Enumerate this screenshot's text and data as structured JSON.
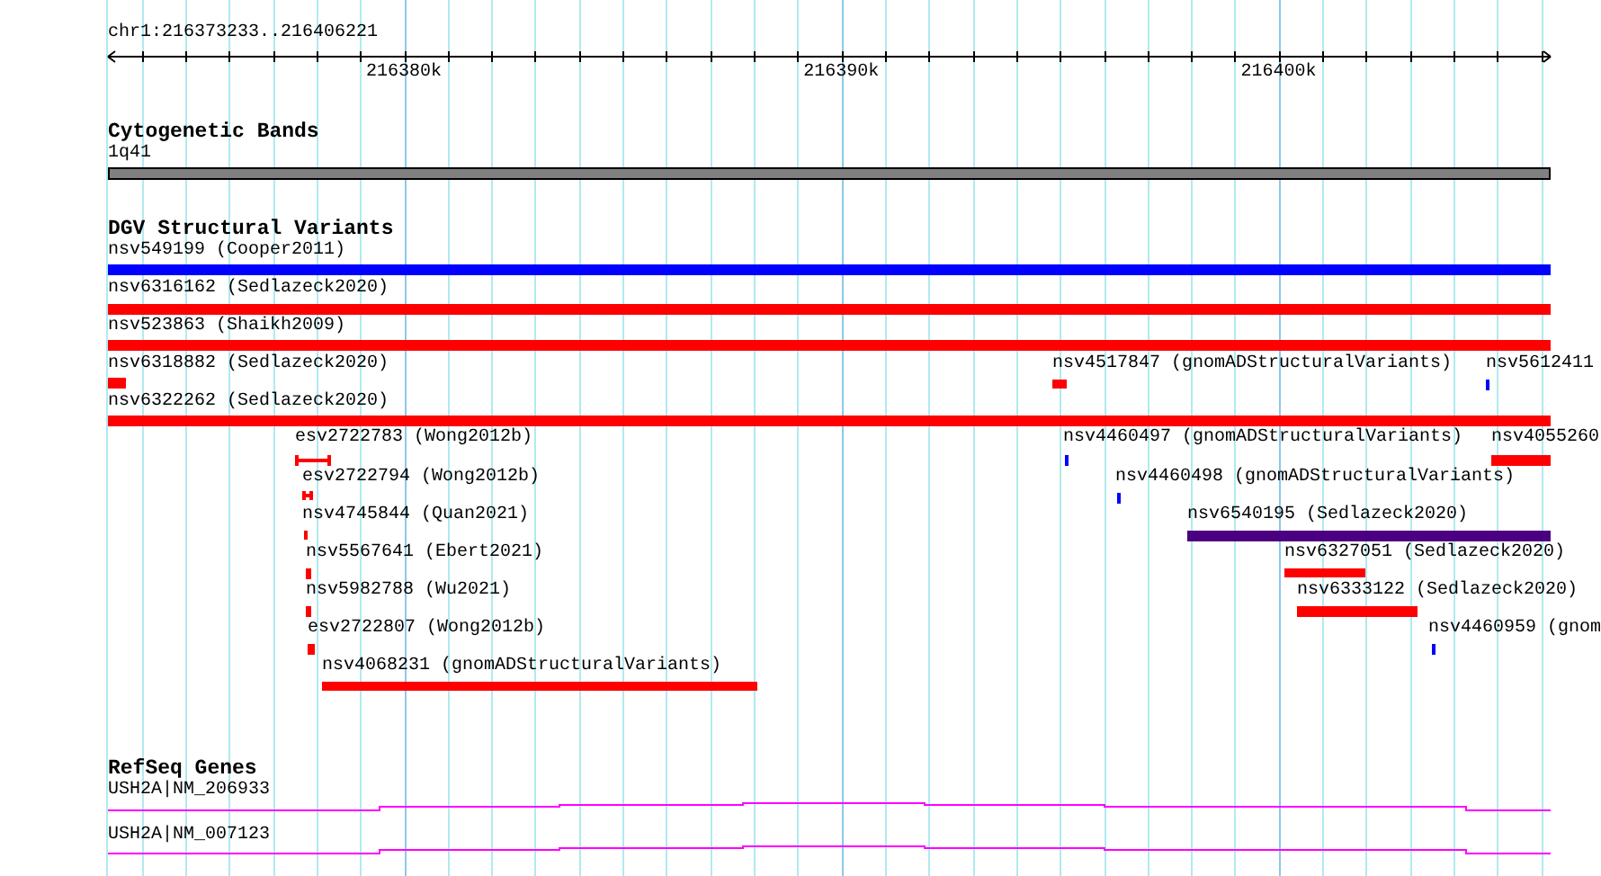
{
  "ruler": {
    "location": "chr1:216373233..216406221",
    "ticks": [
      "216380k",
      "216390k",
      "216400k"
    ]
  },
  "tracks": [
    {
      "kind": "cytoband",
      "title": "Cytogenetic Bands",
      "band": "1q41"
    },
    {
      "kind": "variants",
      "title": "DGV Structural Variants",
      "features": [
        {
          "label": "nsv549199 (Cooper2011)",
          "color": "#0000ff",
          "kind": "bar"
        },
        {
          "label": "nsv6316162 (Sedlazeck2020)",
          "color": "#ff0000",
          "kind": "bar"
        },
        {
          "label": "nsv523863 (Shaikh2009)",
          "color": "#ff0000",
          "kind": "bar"
        },
        {
          "label": "nsv6318882 (Sedlazeck2020)",
          "color": "#ff0000",
          "kind": "bar"
        },
        {
          "label": "nsv4517847 (gnomADStructuralVariants)",
          "color": "#ff0000",
          "kind": "bar"
        },
        {
          "label": "nsv5612411",
          "color": "#0000ff",
          "kind": "bar"
        },
        {
          "label": "nsv6322262 (Sedlazeck2020)",
          "color": "#ff0000",
          "kind": "bar"
        },
        {
          "label": "esv2722783 (Wong2012b)",
          "color": "#ff0000",
          "kind": "interval"
        },
        {
          "label": "nsv4460497 (gnomADStructuralVariants)",
          "color": "#0000ff",
          "kind": "bar"
        },
        {
          "label": "nsv4055260",
          "color": "#ff0000",
          "kind": "bar"
        },
        {
          "label": "esv2722794 (Wong2012b)",
          "color": "#ff0000",
          "kind": "interval"
        },
        {
          "label": "nsv4460498 (gnomADStructuralVariants)",
          "color": "#0000ff",
          "kind": "bar"
        },
        {
          "label": "nsv4745844 (Quan2021)",
          "color": "#ff0000",
          "kind": "bar"
        },
        {
          "label": "nsv6540195 (Sedlazeck2020)",
          "color": "#4b0082",
          "kind": "bar"
        },
        {
          "label": "nsv5567641 (Ebert2021)",
          "color": "#ff0000",
          "kind": "bar"
        },
        {
          "label": "nsv6327051 (Sedlazeck2020)",
          "color": "#ff0000",
          "kind": "bar"
        },
        {
          "label": "nsv5982788 (Wu2021)",
          "color": "#ff0000",
          "kind": "bar"
        },
        {
          "label": "nsv6333122 (Sedlazeck2020)",
          "color": "#ff0000",
          "kind": "bar"
        },
        {
          "label": "esv2722807 (Wong2012b)",
          "color": "#ff0000",
          "kind": "bar"
        },
        {
          "label": "nsv4460959 (gnom",
          "color": "#0000ff",
          "kind": "bar"
        },
        {
          "label": "nsv4068231 (gnomADStructuralVariants)",
          "color": "#ff0000",
          "kind": "bar"
        }
      ]
    },
    {
      "kind": "genes",
      "title": "RefSeq Genes",
      "genes": [
        {
          "label": "USH2A|NM_206933"
        },
        {
          "label": "USH2A|NM_007123"
        }
      ]
    }
  ]
}
